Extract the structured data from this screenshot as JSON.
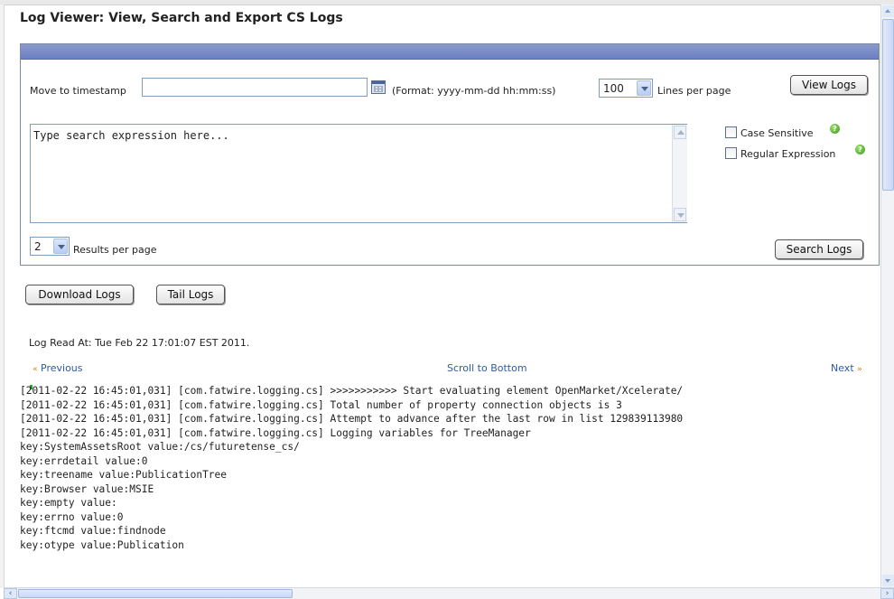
{
  "page": {
    "title": "Log Viewer: View, Search and Export CS Logs"
  },
  "controls": {
    "timestamp_label": "Move to timestamp",
    "timestamp_value": "",
    "format_hint": "(Format: yyyy-mm-dd hh:mm:ss)",
    "lines_per_page_value": "100",
    "lines_per_page_label": "Lines per page",
    "view_logs_label": "View Logs",
    "search_placeholder": "Type search expression here...",
    "case_sensitive_label": "Case Sensitive",
    "regex_label": "Regular Expression",
    "results_per_page_value": "2",
    "results_per_page_label": "Results per page",
    "search_logs_label": "Search Logs"
  },
  "actions": {
    "download_logs_label": "Download Logs",
    "tail_logs_label": "Tail Logs"
  },
  "status": {
    "log_read_at": "Log Read At: Tue Feb 22 17:01:07 EST 2011."
  },
  "navigation": {
    "previous_label": "Previous",
    "scroll_bottom_label": "Scroll to Bottom",
    "next_label": "Next"
  },
  "log_lines": [
    "[2011-02-22 16:45:01,031] [com.fatwire.logging.cs] >>>>>>>>>>> Start evaluating element OpenMarket/Xcelerate/",
    "[2011-02-22 16:45:01,031] [com.fatwire.logging.cs] Total number of property connection objects is 3",
    "[2011-02-22 16:45:01,031] [com.fatwire.logging.cs] Attempt to advance after the last row in list 129839113980",
    "[2011-02-22 16:45:01,031] [com.fatwire.logging.cs] Logging variables for TreeManager",
    "key:SystemAssetsRoot value:/cs/futuretense_cs/",
    "key:errdetail value:0",
    "key:treename value:PublicationTree",
    "key:Browser value:MSIE",
    "key:empty value:",
    "key:errno value:0",
    "key:ftcmd value:findnode",
    "key:otype value:Publication"
  ]
}
